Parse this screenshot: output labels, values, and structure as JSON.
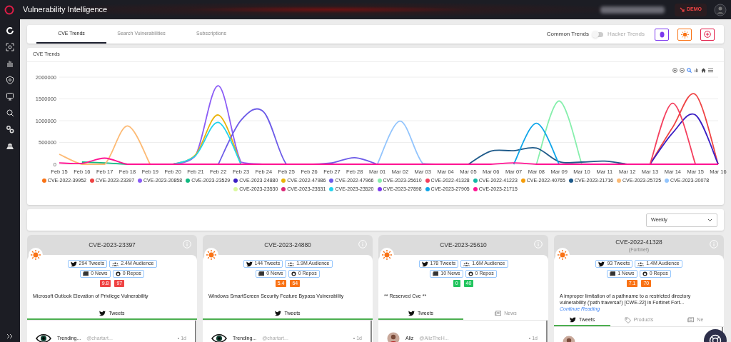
{
  "app": {
    "title": "Vulnerability Intelligence",
    "demo": "DEMO"
  },
  "tabs": [
    {
      "label": "CVE Trends",
      "selected": true
    },
    {
      "label": "Search Vulnerabilities",
      "selected": false
    },
    {
      "label": "Subscriptions",
      "selected": false
    }
  ],
  "trend_toggle": {
    "left": "Common Trends",
    "right": "Hacker Trends",
    "on": false
  },
  "chart_panel": {
    "title": "CVE Trends",
    "chart_data": {
      "type": "line",
      "grid": true,
      "ylim": [
        0,
        2000000
      ],
      "yticks": [
        0,
        500000,
        1000000,
        1500000,
        2000000
      ],
      "categories": [
        "Feb 15",
        "Feb 16",
        "Feb 17",
        "Feb 18",
        "Feb 19",
        "Feb 20",
        "Feb 21",
        "Feb 22",
        "Feb 23",
        "Feb 24",
        "Feb 25",
        "Feb 26",
        "Feb 27",
        "Feb 28",
        "Mar 01",
        "Mar 02",
        "Mar 03",
        "Mar 04",
        "Mar 05",
        "Mar 06",
        "Mar 07",
        "Mar 08",
        "Mar 09",
        "Mar 10",
        "Mar 11",
        "Mar 12",
        "Mar 13",
        "Mar 14",
        "Mar 15",
        "Mar 16"
      ],
      "series": [
        {
          "name": "CVE-2022-39952",
          "color": "#f97316",
          "values": [
            null,
            null,
            null,
            null,
            null,
            null,
            null,
            null,
            null,
            null,
            null,
            null,
            null,
            null,
            null,
            null,
            null,
            null,
            null,
            null,
            null,
            null,
            null,
            null,
            null,
            null,
            null,
            null,
            null,
            null
          ]
        },
        {
          "name": "CVE-2023-23397",
          "color": "#ef4444",
          "values": [
            null,
            null,
            null,
            null,
            null,
            null,
            null,
            null,
            null,
            null,
            null,
            null,
            null,
            null,
            null,
            null,
            null,
            null,
            null,
            null,
            null,
            null,
            null,
            null,
            null,
            null,
            0,
            850000,
            1600000,
            0
          ]
        },
        {
          "name": "CVE-2023-20858",
          "color": "#8b5cf6",
          "values": [
            null,
            null,
            null,
            null,
            null,
            0,
            200000,
            1800000,
            50000,
            0,
            null,
            null,
            null,
            null,
            null,
            null,
            null,
            null,
            null,
            null,
            null,
            null,
            null,
            null,
            null,
            null,
            null,
            null,
            null,
            null
          ]
        },
        {
          "name": "CVE-2023-23529",
          "color": "#10b981",
          "values": [
            null,
            50000,
            30000,
            0,
            null,
            null,
            null,
            null,
            null,
            null,
            null,
            null,
            null,
            null,
            null,
            null,
            null,
            null,
            null,
            null,
            null,
            null,
            null,
            null,
            null,
            null,
            null,
            null,
            null,
            null
          ]
        },
        {
          "name": "CVE-2023-24880",
          "color": "#3b1fc4",
          "values": [
            null,
            null,
            null,
            null,
            null,
            null,
            null,
            null,
            null,
            null,
            null,
            null,
            null,
            null,
            null,
            null,
            null,
            null,
            null,
            null,
            null,
            null,
            null,
            null,
            null,
            null,
            0,
            720000,
            1130000,
            0
          ]
        },
        {
          "name": "CVE-2022-47986",
          "color": "#eab308",
          "values": [
            null,
            null,
            null,
            null,
            null,
            0,
            220000,
            1130000,
            0,
            null,
            null,
            null,
            null,
            null,
            null,
            null,
            null,
            null,
            null,
            null,
            null,
            null,
            null,
            null,
            null,
            null,
            null,
            null,
            null,
            null
          ]
        },
        {
          "name": "CVE-2022-47966",
          "color": "#6d5ce8",
          "values": [
            null,
            null,
            null,
            null,
            null,
            null,
            null,
            0,
            1010000,
            1200000,
            0,
            0,
            30000,
            150000,
            0,
            null,
            null,
            null,
            null,
            null,
            null,
            null,
            null,
            null,
            null,
            null,
            null,
            null,
            null,
            null
          ]
        },
        {
          "name": "CVE-2023-25610",
          "color": "#86efac",
          "values": [
            null,
            null,
            null,
            null,
            null,
            null,
            null,
            null,
            null,
            null,
            null,
            null,
            null,
            null,
            null,
            null,
            null,
            null,
            null,
            null,
            null,
            0,
            1450000,
            0,
            null,
            null,
            null,
            null,
            null,
            null
          ]
        },
        {
          "name": "CVE-2022-41328",
          "color": "#f43f5e",
          "values": [
            null,
            null,
            null,
            null,
            null,
            null,
            null,
            null,
            null,
            null,
            null,
            null,
            null,
            null,
            null,
            null,
            null,
            null,
            null,
            null,
            null,
            null,
            null,
            null,
            null,
            null,
            0,
            1400000,
            0,
            null
          ]
        },
        {
          "name": "CVE-2022-41223",
          "color": "#14b8a6",
          "values": [
            null,
            null,
            null,
            null,
            null,
            null,
            null,
            null,
            null,
            null,
            null,
            null,
            null,
            null,
            null,
            null,
            null,
            null,
            null,
            null,
            null,
            null,
            null,
            null,
            null,
            null,
            null,
            null,
            null,
            null
          ]
        },
        {
          "name": "CVE-2022-40765",
          "color": "#f59e0b",
          "values": [
            null,
            null,
            null,
            null,
            null,
            null,
            null,
            null,
            null,
            null,
            null,
            null,
            null,
            null,
            null,
            null,
            null,
            null,
            null,
            null,
            null,
            null,
            null,
            null,
            null,
            null,
            null,
            null,
            null,
            null
          ]
        },
        {
          "name": "CVE-2023-21716",
          "color": "#1e5a8a",
          "values": [
            null,
            null,
            null,
            null,
            null,
            null,
            null,
            null,
            null,
            null,
            null,
            null,
            null,
            null,
            null,
            null,
            null,
            null,
            0,
            300000,
            310000,
            370000,
            60000,
            50000,
            70000,
            0,
            null,
            null,
            null,
            null
          ]
        },
        {
          "name": "CVE-2023-25725",
          "color": "#fdba74",
          "values": [
            230000,
            0,
            0,
            880000,
            0,
            null,
            null,
            null,
            null,
            null,
            null,
            null,
            null,
            null,
            null,
            null,
            null,
            null,
            null,
            null,
            null,
            null,
            null,
            null,
            null,
            null,
            null,
            null,
            null,
            null
          ]
        },
        {
          "name": "CVE-2023-20078",
          "color": "#93c5fd",
          "values": [
            null,
            null,
            null,
            null,
            null,
            null,
            null,
            null,
            null,
            null,
            null,
            null,
            null,
            null,
            0,
            990000,
            20000,
            0,
            null,
            null,
            null,
            null,
            null,
            null,
            null,
            null,
            null,
            null,
            null,
            null
          ]
        },
        {
          "name": "CVE-2023-23530",
          "color": "#d9f99d",
          "values": [
            null,
            null,
            null,
            null,
            null,
            null,
            null,
            null,
            null,
            null,
            null,
            null,
            null,
            null,
            null,
            null,
            null,
            null,
            null,
            null,
            null,
            null,
            null,
            null,
            null,
            null,
            null,
            null,
            null,
            null
          ]
        },
        {
          "name": "CVE-2023-23531",
          "color": "#db2777",
          "values": [
            null,
            null,
            null,
            null,
            null,
            null,
            null,
            null,
            null,
            null,
            null,
            null,
            null,
            null,
            null,
            null,
            null,
            null,
            null,
            null,
            null,
            null,
            null,
            null,
            null,
            null,
            null,
            null,
            null,
            null
          ]
        },
        {
          "name": "CVE-2023-23520",
          "color": "#22d3ee",
          "values": [
            null,
            null,
            null,
            null,
            null,
            0,
            200000,
            960000,
            0,
            null,
            null,
            null,
            null,
            null,
            null,
            null,
            null,
            null,
            null,
            null,
            null,
            null,
            null,
            null,
            null,
            null,
            null,
            null,
            null,
            null
          ]
        },
        {
          "name": "CVE-2023-27898",
          "color": "#7c3aed",
          "values": [
            null,
            null,
            null,
            null,
            null,
            null,
            null,
            null,
            null,
            null,
            null,
            null,
            null,
            null,
            null,
            null,
            null,
            null,
            null,
            null,
            null,
            null,
            null,
            null,
            null,
            null,
            null,
            null,
            null,
            null
          ]
        },
        {
          "name": "CVE-2023-27905",
          "color": "#0ea5e9",
          "values": [
            null,
            null,
            null,
            null,
            null,
            null,
            null,
            null,
            null,
            null,
            null,
            null,
            null,
            null,
            null,
            null,
            null,
            null,
            null,
            null,
            0,
            940000,
            0,
            null,
            null,
            null,
            null,
            null,
            null,
            null
          ]
        },
        {
          "name": "CVE-2023-21715",
          "color": "#ff1493",
          "values": [
            30000,
            20000,
            140000,
            0,
            0,
            0,
            0,
            0,
            0,
            0,
            0,
            0,
            0,
            0,
            0,
            0,
            0,
            0,
            0,
            0,
            30000,
            0,
            0,
            0,
            0,
            0,
            0,
            0,
            0,
            0
          ]
        }
      ]
    }
  },
  "period": {
    "value": "Weekly"
  },
  "cards": [
    {
      "cve": "CVE-2023-23397",
      "tweets": "294 Tweets",
      "audience": "2.4M Audience",
      "news": "0 News",
      "repos": "0 Repos",
      "scores": [
        {
          "value": "9.8",
          "color": "#ef4444"
        },
        {
          "value": "97",
          "color": "#ef4444"
        }
      ],
      "description": "Microsoft Outlook Elevation of Privilege Vulnerability",
      "tabs": [
        {
          "kind": "tweets",
          "label": "Tweets",
          "selected": true
        }
      ],
      "tweet": {
        "name": "Trending...",
        "handle": "@chartart...",
        "time": "• 1d",
        "kind": "eye"
      }
    },
    {
      "cve": "CVE-2023-24880",
      "tweets": "144 Tweets",
      "audience": "1.9M Audience",
      "news": "0 News",
      "repos": "0 Repos",
      "scores": [
        {
          "value": "5.4",
          "color": "#f97316"
        },
        {
          "value": "64",
          "color": "#f97316"
        }
      ],
      "description": "Windows SmartScreen Security Feature Bypass Vulnerability",
      "tabs": [
        {
          "kind": "tweets",
          "label": "Tweets",
          "selected": true
        }
      ],
      "tweet": {
        "name": "Trending...",
        "handle": "@chartart...",
        "time": "• 1d",
        "kind": "eye"
      }
    },
    {
      "cve": "CVE-2023-25610",
      "tweets": "178 Tweets",
      "audience": "1.6M Audience",
      "news": "10 News",
      "repos": "0 Repos",
      "scores": [
        {
          "value": "0",
          "color": "#22c55e"
        },
        {
          "value": "40",
          "color": "#22c55e"
        }
      ],
      "description": "** Reserved Cve **",
      "tabs": [
        {
          "kind": "tweets",
          "label": "Tweets",
          "selected": true
        },
        {
          "kind": "news",
          "label": "News",
          "selected": false
        }
      ],
      "tweet": {
        "name": "Aliz",
        "handle": "@AlizTheH...",
        "time": "• 1d",
        "kind": "person"
      }
    },
    {
      "cve": "CVE-2022-41328",
      "vendor": "(Fortinet)",
      "tweets": "93 Tweets",
      "audience": "1.4M Audience",
      "news": "1 News",
      "repos": "0 Repos",
      "scores": [
        {
          "value": "7.1",
          "color": "#f97316"
        },
        {
          "value": "70",
          "color": "#f97316"
        }
      ],
      "description": "A improper limitation of a pathname to a restricted directory vulnerability ('path traversal') [CWE-22] in Fortinet Fort...",
      "more": "Continue Reading",
      "tabs": [
        {
          "kind": "tweets",
          "label": "Tweets",
          "selected": true
        },
        {
          "kind": "products",
          "label": "Products",
          "selected": false
        },
        {
          "kind": "news",
          "label": "Ne",
          "selected": false
        }
      ],
      "tweet": {
        "kind": "person"
      }
    }
  ]
}
